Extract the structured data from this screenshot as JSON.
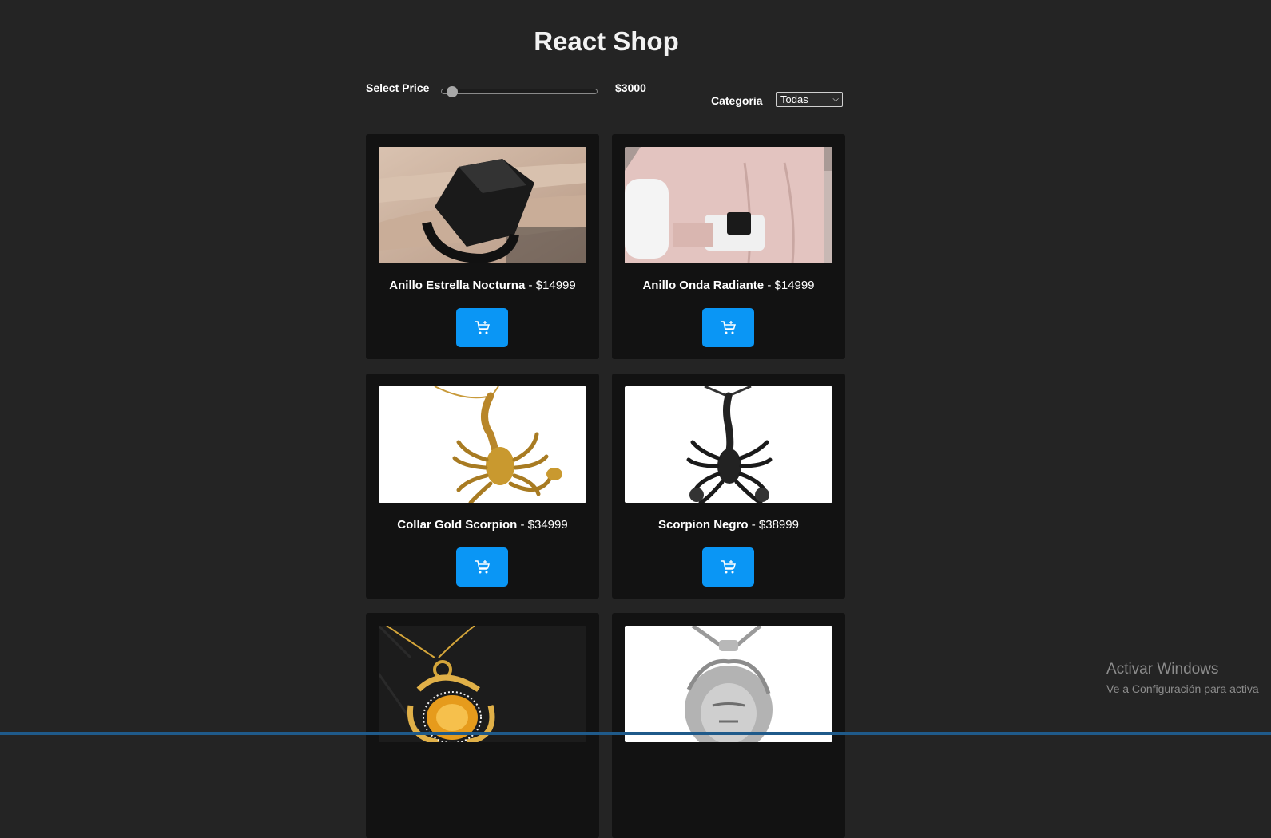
{
  "header": {
    "title": "React Shop"
  },
  "filters": {
    "price_label": "Select Price",
    "price_value": "$3000",
    "price_slider_fraction": 0.04,
    "category_label": "Categoria",
    "category_selected": "Todas"
  },
  "products": [
    {
      "name": "Anillo Estrella Nocturna",
      "price": "- $14999",
      "image": "black-ring"
    },
    {
      "name": "Anillo Onda Radiante",
      "price": "- $14999",
      "image": "silver-ring"
    },
    {
      "name": "Collar Gold Scorpion",
      "price": "- $34999",
      "image": "gold-scorpion"
    },
    {
      "name": "Scorpion Negro",
      "price": "- $38999",
      "image": "black-scorpion"
    },
    {
      "name": "",
      "price": "",
      "image": "gold-gem-pendant"
    },
    {
      "name": "",
      "price": "",
      "image": "silver-lion-pendant"
    }
  ],
  "icons": {
    "cart_button": "cart-add-icon"
  },
  "colors": {
    "page_bg": "#242424",
    "card_bg": "#121212",
    "accent": "#0a96f5"
  },
  "watermark": {
    "line1": "Activar Windows",
    "line2": "Ve a Configuración para activa"
  }
}
